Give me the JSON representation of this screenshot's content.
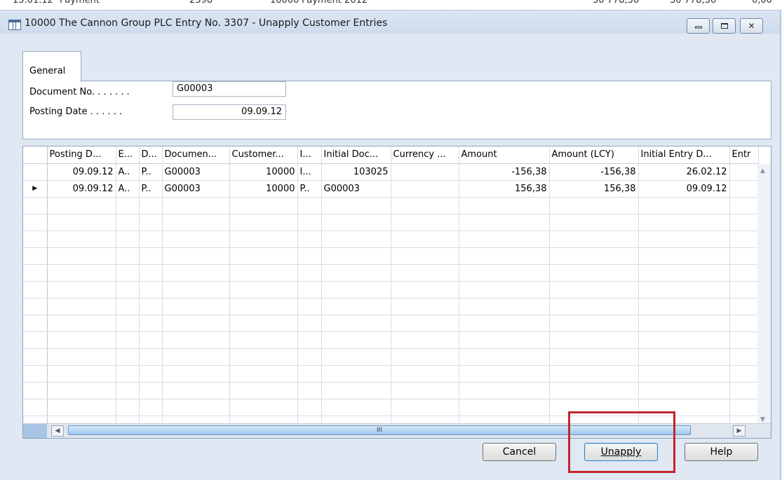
{
  "background_row": {
    "cells": [
      "15.01.12",
      "Payment",
      "2398",
      "10000",
      "Payment 2012",
      "30 778,36",
      "30 778,36",
      "0,00"
    ]
  },
  "window": {
    "title": "10000 The Cannon Group PLC Entry No. 3307 - Unapply Customer Entries"
  },
  "tabs": [
    {
      "label": "General"
    }
  ],
  "general": {
    "document_no_label": "Document No. . . . . . .",
    "document_no_value": "G00003",
    "posting_date_label": "Posting Date . . . . . .",
    "posting_date_value": "09.09.12"
  },
  "grid": {
    "columns": [
      "Posting D...",
      "E...",
      "D...",
      "Documen...",
      "Customer...",
      "I...",
      "Initial Doc...",
      "Currency ...",
      "Amount",
      "Amount (LCY)",
      "Initial Entry D...",
      "Entr"
    ],
    "rows": [
      {
        "selected": false,
        "cells": [
          "09.09.12",
          "A..",
          "P..",
          "G00003",
          "10000",
          "I...",
          "103025",
          "",
          "-156,38",
          "-156,38",
          "26.02.12",
          ""
        ]
      },
      {
        "selected": true,
        "cells": [
          "09.09.12",
          "A..",
          "P..",
          "G00003",
          "10000",
          "P..",
          "G00003",
          "",
          "156,38",
          "156,38",
          "09.09.12",
          ""
        ]
      }
    ],
    "scroll_thumb_label": "III"
  },
  "buttons": {
    "cancel": "Cancel",
    "unapply": "Unapply",
    "help": "Help"
  }
}
